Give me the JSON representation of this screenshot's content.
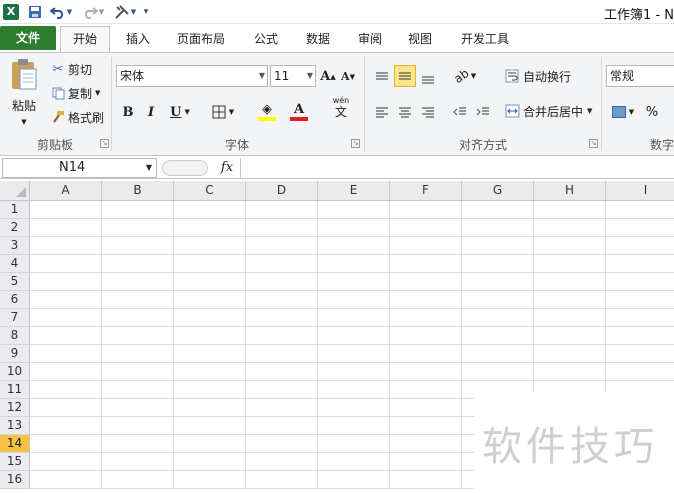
{
  "window": {
    "title": "工作簿1 - N"
  },
  "quick_access": {
    "app_icon": "X",
    "save_icon": "floppy-icon",
    "undo_icon": "undo-icon",
    "redo_icon": "redo-icon",
    "tools_icon": "tools-icon",
    "customize_icon": "customize-icon"
  },
  "tabs": [
    {
      "label": "文件"
    },
    {
      "label": "开始"
    },
    {
      "label": "插入"
    },
    {
      "label": "页面布局"
    },
    {
      "label": "公式"
    },
    {
      "label": "数据"
    },
    {
      "label": "审阅"
    },
    {
      "label": "视图"
    },
    {
      "label": "开发工具"
    }
  ],
  "clipboard": {
    "paste": "粘贴",
    "cut": "剪切",
    "copy": "复制",
    "format_painter": "格式刷",
    "group": "剪贴板"
  },
  "font": {
    "name": "宋体",
    "size": "11",
    "grow": "A",
    "shrink": "A",
    "bold": "B",
    "italic": "I",
    "underline": "U",
    "font_color_letter": "A",
    "phonetic_top": "wén",
    "phonetic_bottom": "文",
    "group": "字体",
    "fill_color": "#ffff00",
    "text_color": "#e02020"
  },
  "alignment": {
    "wrap_text": "自动换行",
    "merge_center": "合并后居中",
    "group": "对齐方式"
  },
  "number": {
    "format": "常规",
    "percent": "%",
    "group": "数字"
  },
  "formula_bar": {
    "name_box": "N14",
    "fx": "fx",
    "value": ""
  },
  "sheet": {
    "columns": [
      "A",
      "B",
      "C",
      "D",
      "E",
      "F",
      "G",
      "H",
      "I"
    ],
    "rows": [
      "1",
      "2",
      "3",
      "4",
      "5",
      "6",
      "7",
      "8",
      "9",
      "10",
      "11",
      "12",
      "13",
      "14",
      "15",
      "16"
    ],
    "active_row": "14",
    "active_row_color": "#f6c243"
  },
  "watermark": {
    "text": "软件技巧"
  }
}
